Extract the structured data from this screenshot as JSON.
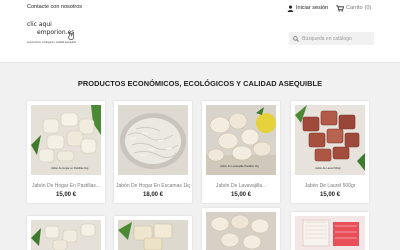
{
  "topbar": {
    "contact_label": "Contacte con nosotros",
    "login_label": "Iniciar sesión",
    "cart_label": "Carrito",
    "cart_count": "(0)"
  },
  "logo": {
    "line1": "clic aqui",
    "line2": "emporion.es",
    "tagline": "economicos, ecologicos, calidad asequible"
  },
  "search": {
    "placeholder": "Búsqueda en catálogo"
  },
  "section": {
    "title": "PRODUCTOS ECONÓMICOS, ECOLÓGICOS Y CALIDAD ASEQUIBLE"
  },
  "products": [
    {
      "name": "Jabón De Hogar En Pastillas...",
      "price": "15,00 €",
      "image_label": "Jabón de Hogar en Pastillas 1kg"
    },
    {
      "name": "Jabón De Hogar En Escamas 1kg",
      "price": "18,00 €",
      "image_label": ""
    },
    {
      "name": "Jabón De Lavavajilla...",
      "price": "15,00 €",
      "image_label": "Jabón de Lavavajilla Pastillas 1kg"
    },
    {
      "name": "Jabón De Laurel 500gr",
      "price": "15,00 €",
      "image_label": "Jabón de Laurel 500gr"
    }
  ],
  "colors": {
    "page_bg": "#f1f1f1",
    "header_bg": "#ffffff",
    "text": "#232323",
    "muted": "#7a7a7a"
  }
}
